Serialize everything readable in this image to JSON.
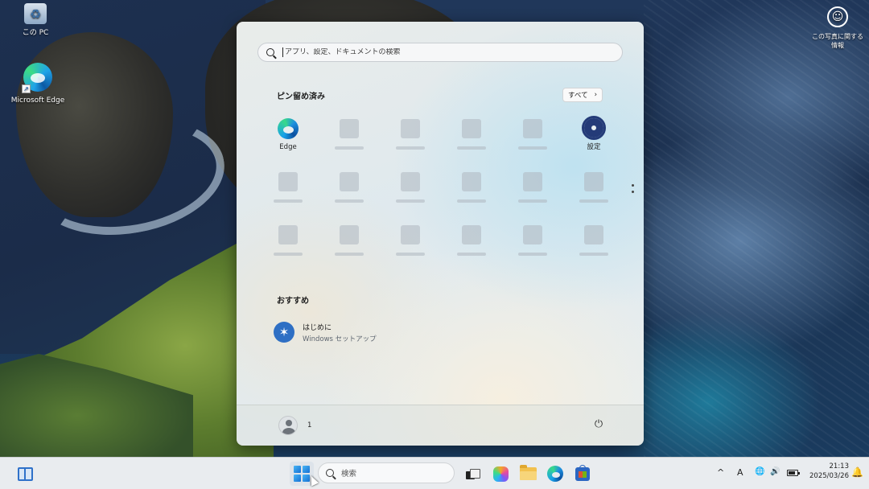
{
  "desktop": {
    "icons": [
      {
        "label": "この PC",
        "icon": "recycle-bin-icon"
      },
      {
        "label": "Microsoft Edge",
        "icon": "edge-icon"
      }
    ],
    "top_right_badge": {
      "icon": "accessibility-icon",
      "line1": "この写真に関する",
      "line2": "情報"
    }
  },
  "start_menu": {
    "search": {
      "placeholder": "アプリ、設定、ドキュメントの検索"
    },
    "pinned": {
      "title": "ピン留め済み",
      "all_button": "すべて",
      "all_chevron": "›",
      "apps": [
        {
          "label": "Edge",
          "icon": "edge-icon"
        },
        {
          "label": "",
          "icon": "placeholder"
        },
        {
          "label": "",
          "icon": "placeholder"
        },
        {
          "label": "",
          "icon": "placeholder"
        },
        {
          "label": "",
          "icon": "placeholder"
        },
        {
          "label": "設定",
          "icon": "settings-gear-icon"
        }
      ]
    },
    "recommended": {
      "title": "おすすめ",
      "items": [
        {
          "title": "はじめに",
          "subtitle": "Windows セットアップ",
          "icon": "windows-setup-icon"
        }
      ]
    },
    "footer": {
      "user_name": "1",
      "power_icon": "⏻"
    }
  },
  "taskbar": {
    "search_placeholder": "検索",
    "apps": [
      "widgets-icon",
      "start-icon",
      "task-view-icon",
      "copilot-icon",
      "file-explorer-icon",
      "edge-icon",
      "store-icon"
    ],
    "tray": {
      "chevron": "^",
      "ime": "A",
      "globe": "🌐",
      "volume": "🔊",
      "time": "21:13",
      "date": "2025/03/26",
      "notification_icon": "🔔"
    }
  },
  "colors": {
    "accent": "#2f71c9",
    "settings_icon": "#243b78",
    "setup_icon": "#2e6fc4"
  }
}
